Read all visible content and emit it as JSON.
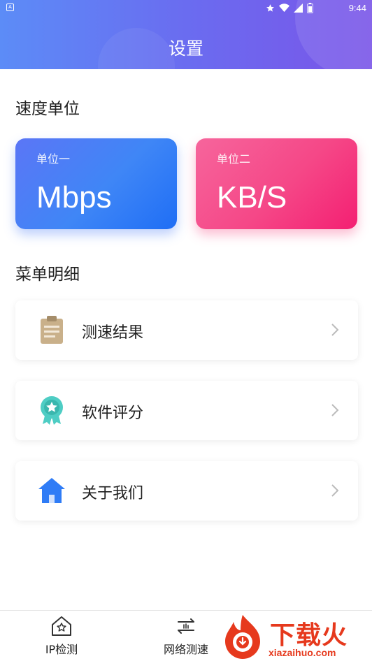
{
  "status_bar": {
    "notification_icon": "A",
    "icons": [
      "star-icon",
      "wifi-icon",
      "signal-icon",
      "battery-icon"
    ],
    "time": "9:44"
  },
  "header": {
    "title": "设置",
    "gradient_colors": [
      "#5c8cf7",
      "#7a55e8"
    ]
  },
  "speed_unit": {
    "section_title": "速度单位",
    "units": [
      {
        "sub_label": "单位一",
        "value": "Mbps",
        "color": "#3f86f6"
      },
      {
        "sub_label": "单位二",
        "value": "KB/S",
        "color": "#f54787"
      }
    ]
  },
  "menu": {
    "section_title": "菜单明细",
    "items": [
      {
        "label": "测速结果",
        "icon": "clipboard-icon"
      },
      {
        "label": "软件评分",
        "icon": "award-icon"
      },
      {
        "label": "关于我们",
        "icon": "home-icon"
      }
    ]
  },
  "tab_bar": {
    "tabs": [
      {
        "label": "IP检测",
        "icon": "house-star-icon"
      },
      {
        "label": "网络测速",
        "icon": "speed-test-icon"
      }
    ]
  },
  "watermark": {
    "text": "下载火",
    "domain": "xiazaihuo.com",
    "color": "#e6391d"
  }
}
